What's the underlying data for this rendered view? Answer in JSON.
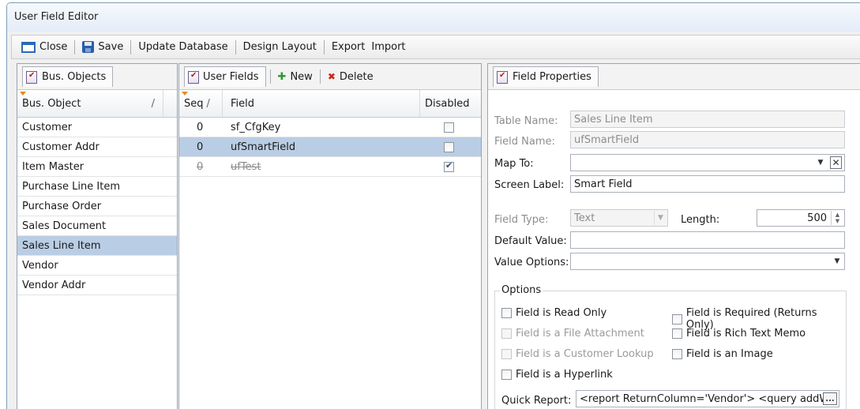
{
  "window": {
    "title": "User Field Editor"
  },
  "toolbar": {
    "close_label": "Close",
    "save_label": "Save",
    "update_db_label": "Update Database",
    "design_layout_label": "Design Layout",
    "export_label": "Export",
    "import_label": "Import"
  },
  "bus_objects": {
    "tab_label": "Bus. Objects",
    "column_header": "Bus. Object",
    "sort_glyph": "/",
    "items": [
      "Customer",
      "Customer Addr",
      "Item Master",
      "Purchase Line Item",
      "Purchase Order",
      "Sales Document",
      "Sales Line Item",
      "Vendor",
      "Vendor Addr"
    ],
    "selected": "Sales Line Item"
  },
  "user_fields": {
    "tab_label": "User Fields",
    "new_label": "New",
    "delete_label": "Delete",
    "headers": {
      "seq": "Seq",
      "seq_sort_glyph": "/",
      "field": "Field",
      "disabled": "Disabled"
    },
    "rows": [
      {
        "seq": "0",
        "field": "sf_CfgKey",
        "disabled": false,
        "selected": false,
        "deleted": false
      },
      {
        "seq": "0",
        "field": "ufSmartField",
        "disabled": false,
        "selected": true,
        "deleted": false
      },
      {
        "seq": "0",
        "field": "ufTest",
        "disabled": true,
        "selected": false,
        "deleted": true
      }
    ]
  },
  "field_properties": {
    "tab_label": "Field Properties",
    "table_name_label": "Table Name:",
    "table_name_value": "Sales Line Item",
    "field_name_label": "Field Name:",
    "field_name_value": "ufSmartField",
    "map_to_label": "Map To:",
    "map_to_value": "",
    "screen_label_label": "Screen Label:",
    "screen_label_value": "Smart Field",
    "field_type_label": "Field Type:",
    "field_type_value": "Text",
    "length_label": "Length:",
    "length_value": "500",
    "default_value_label": "Default Value:",
    "default_value_value": "",
    "value_options_label": "Value Options:",
    "value_options_value": "",
    "options": {
      "legend": "Options",
      "read_only": "Field is Read Only",
      "file_attachment": "Field is a File Attachment",
      "customer_lookup": "Field is a Customer Lookup",
      "hyperlink": "Field is a Hyperlink",
      "required": "Field is Required (Returns Only)",
      "rich_text": "Field is Rich Text Memo",
      "image": "Field is an Image"
    },
    "quick_report_label": "Quick Report:",
    "quick_report_value": "<report ReturnColumn='Vendor'>   <query addWh",
    "ellipsis_label": "..."
  }
}
